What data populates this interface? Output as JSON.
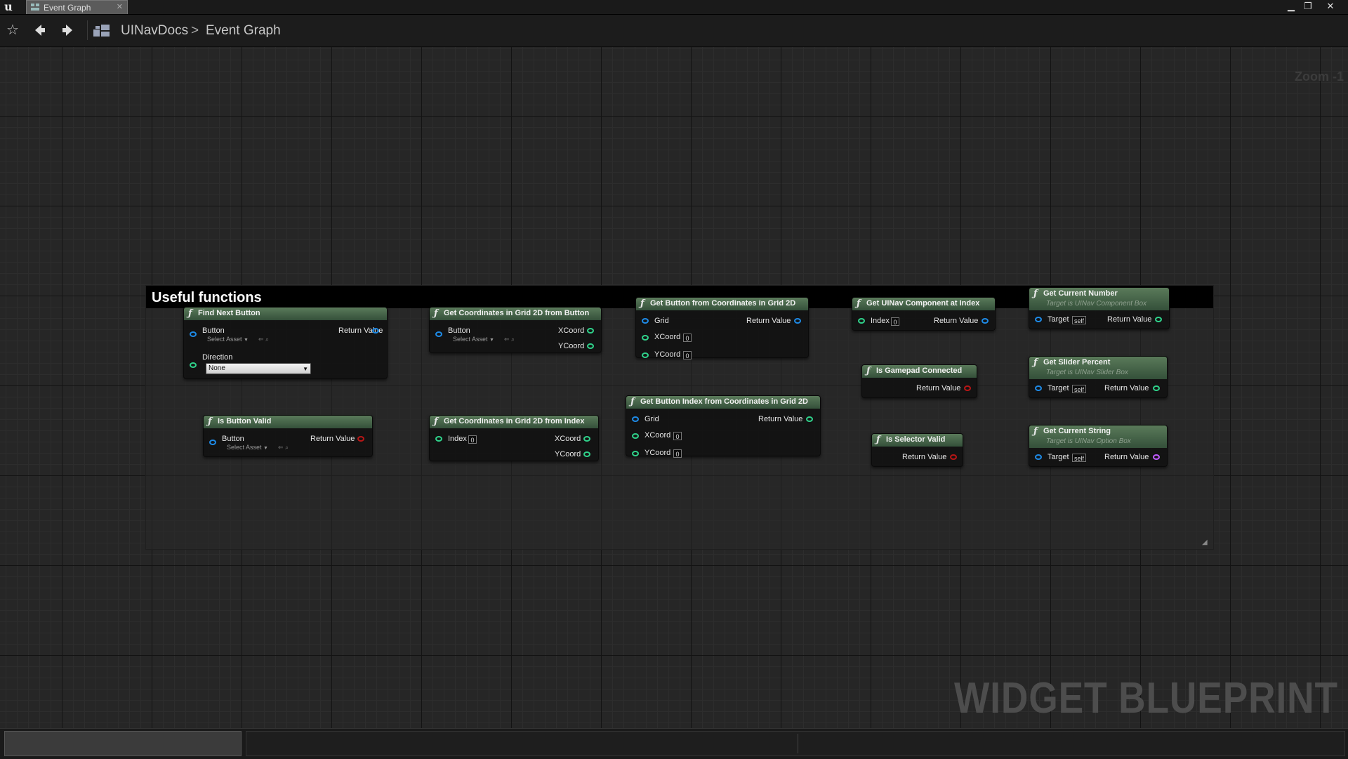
{
  "window": {
    "tab_title": "Event Graph",
    "tab_close": "✕",
    "minimize": "▁",
    "restore": "❐",
    "close": "✕"
  },
  "toolbar": {
    "icons": [
      "star-icon",
      "back-arrow-icon",
      "forward-arrow-icon",
      "blueprint-icon"
    ],
    "breadcrumb": [
      "UINavDocs",
      "Event Graph"
    ],
    "separator": ">",
    "zoom": "Zoom -1"
  },
  "comment": {
    "title": "Useful functions"
  },
  "colors": {
    "pin_object": "#1e8ae6",
    "pin_int": "#2fd18a",
    "pin_bool": "#b81616",
    "pin_string": "#c05aff",
    "node_header": "#4a6a4a"
  },
  "nodes": {
    "find_next_button": {
      "title": "Find Next Button",
      "in_button": "Button",
      "asset_picker": "Select Asset",
      "in_direction": "Direction",
      "direction_value": "None",
      "out_return": "Return Value"
    },
    "is_button_valid": {
      "title": "Is Button Valid",
      "in_button": "Button",
      "asset_picker": "Select Asset",
      "out_return": "Return Value"
    },
    "coords_from_button": {
      "title": "Get Coordinates in Grid 2D from Button",
      "in_button": "Button",
      "asset_picker": "Select Asset",
      "out_x": "XCoord",
      "out_y": "YCoord"
    },
    "coords_from_index": {
      "title": "Get Coordinates in Grid 2D from Index",
      "in_index": "Index",
      "index_value": "0",
      "out_x": "XCoord",
      "out_y": "YCoord"
    },
    "button_from_coords": {
      "title": "Get Button from Coordinates in Grid 2D",
      "in_grid": "Grid",
      "in_x": "XCoord",
      "x_value": "0",
      "in_y": "YCoord",
      "y_value": "0",
      "out_return": "Return Value"
    },
    "index_from_coords": {
      "title": "Get Button Index from Coordinates in Grid 2D",
      "in_grid": "Grid",
      "in_x": "XCoord",
      "x_value": "0",
      "in_y": "YCoord",
      "y_value": "0",
      "out_return": "Return Value"
    },
    "component_at_index": {
      "title": "Get UINav Component at Index",
      "in_index": "Index",
      "index_value": "0",
      "out_return": "Return Value"
    },
    "gamepad_connected": {
      "title": "Is Gamepad Connected",
      "out_return": "Return Value"
    },
    "selector_valid": {
      "title": "Is Selector Valid",
      "out_return": "Return Value"
    },
    "current_number": {
      "title": "Get Current Number",
      "subtitle": "Target is UINav Component Box",
      "in_target": "Target",
      "target_value": "self",
      "out_return": "Return Value"
    },
    "slider_percent": {
      "title": "Get Slider Percent",
      "subtitle": "Target is UINav Slider Box",
      "in_target": "Target",
      "target_value": "self",
      "out_return": "Return Value"
    },
    "current_string": {
      "title": "Get Current String",
      "subtitle": "Target is UINav Option Box",
      "in_target": "Target",
      "target_value": "self",
      "out_return": "Return Value"
    }
  },
  "watermark": "WIDGET BLUEPRINT"
}
